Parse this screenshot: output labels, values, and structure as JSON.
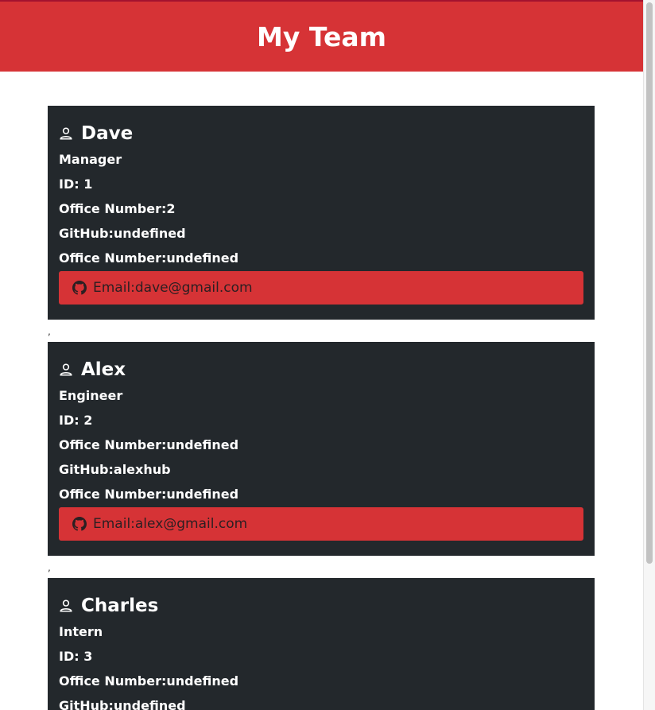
{
  "header": {
    "title": "My Team"
  },
  "separator": ",",
  "cards": [
    {
      "name": "Dave",
      "role": "Manager",
      "id": "ID: 1",
      "office": "Office Number:2",
      "github": "GitHub:undefined",
      "office2": "Office Number:undefined",
      "email": "Email:dave@gmail.com"
    },
    {
      "name": "Alex",
      "role": "Engineer",
      "id": "ID: 2",
      "office": "Office Number:undefined",
      "github": "GitHub:alexhub",
      "office2": "Office Number:undefined",
      "email": "Email:alex@gmail.com"
    },
    {
      "name": "Charles",
      "role": "Intern",
      "id": "ID: 3",
      "office": "Office Number:undefined",
      "github": "GitHub:undefined",
      "office2": "",
      "email": ""
    }
  ],
  "colors": {
    "header_bg": "#d63336",
    "card_bg": "#23282c",
    "button_bg": "#d63336"
  },
  "icons": {
    "person": "person-icon",
    "github": "github-icon"
  }
}
